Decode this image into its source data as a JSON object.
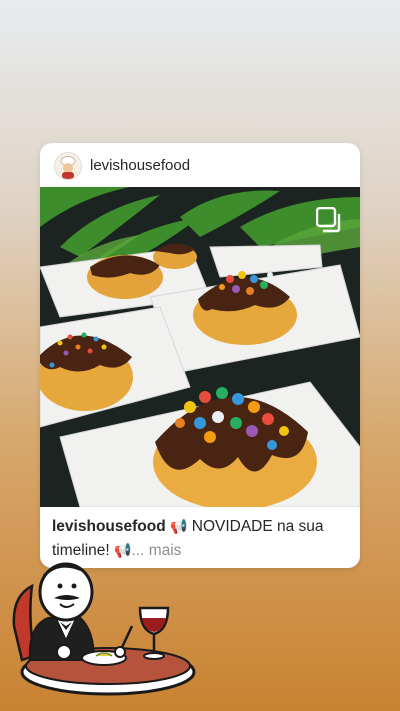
{
  "post": {
    "username": "levishousefood",
    "caption_user": "levishousefood",
    "caption_text": "NOVIDADE na sua timeline!",
    "caption_emoji_1": "📢",
    "caption_emoji_2": "📢",
    "more_label": "... mais",
    "multi_photo_icon": "multiple-photos-icon"
  },
  "sticker": {
    "name": "restaurant-waiter-sticker"
  },
  "colors": {
    "card": "#ffffff",
    "text": "#262626",
    "muted": "#8e8e8e",
    "accent": "#c98231"
  }
}
